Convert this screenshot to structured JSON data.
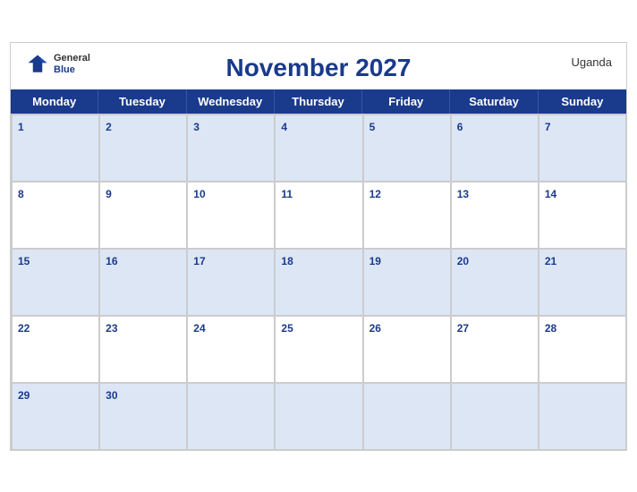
{
  "header": {
    "title": "November 2027",
    "country": "Uganda",
    "logo_general": "General",
    "logo_blue": "Blue"
  },
  "days": [
    "Monday",
    "Tuesday",
    "Wednesday",
    "Thursday",
    "Friday",
    "Saturday",
    "Sunday"
  ],
  "weeks": [
    [
      {
        "num": "1",
        "shaded": true
      },
      {
        "num": "2",
        "shaded": true
      },
      {
        "num": "3",
        "shaded": true
      },
      {
        "num": "4",
        "shaded": true
      },
      {
        "num": "5",
        "shaded": true
      },
      {
        "num": "6",
        "shaded": true
      },
      {
        "num": "7",
        "shaded": true
      }
    ],
    [
      {
        "num": "8",
        "shaded": false
      },
      {
        "num": "9",
        "shaded": false
      },
      {
        "num": "10",
        "shaded": false
      },
      {
        "num": "11",
        "shaded": false
      },
      {
        "num": "12",
        "shaded": false
      },
      {
        "num": "13",
        "shaded": false
      },
      {
        "num": "14",
        "shaded": false
      }
    ],
    [
      {
        "num": "15",
        "shaded": true
      },
      {
        "num": "16",
        "shaded": true
      },
      {
        "num": "17",
        "shaded": true
      },
      {
        "num": "18",
        "shaded": true
      },
      {
        "num": "19",
        "shaded": true
      },
      {
        "num": "20",
        "shaded": true
      },
      {
        "num": "21",
        "shaded": true
      }
    ],
    [
      {
        "num": "22",
        "shaded": false
      },
      {
        "num": "23",
        "shaded": false
      },
      {
        "num": "24",
        "shaded": false
      },
      {
        "num": "25",
        "shaded": false
      },
      {
        "num": "26",
        "shaded": false
      },
      {
        "num": "27",
        "shaded": false
      },
      {
        "num": "28",
        "shaded": false
      }
    ],
    [
      {
        "num": "29",
        "shaded": true
      },
      {
        "num": "30",
        "shaded": true
      },
      {
        "num": "",
        "shaded": true
      },
      {
        "num": "",
        "shaded": true
      },
      {
        "num": "",
        "shaded": true
      },
      {
        "num": "",
        "shaded": true
      },
      {
        "num": "",
        "shaded": true
      }
    ]
  ]
}
